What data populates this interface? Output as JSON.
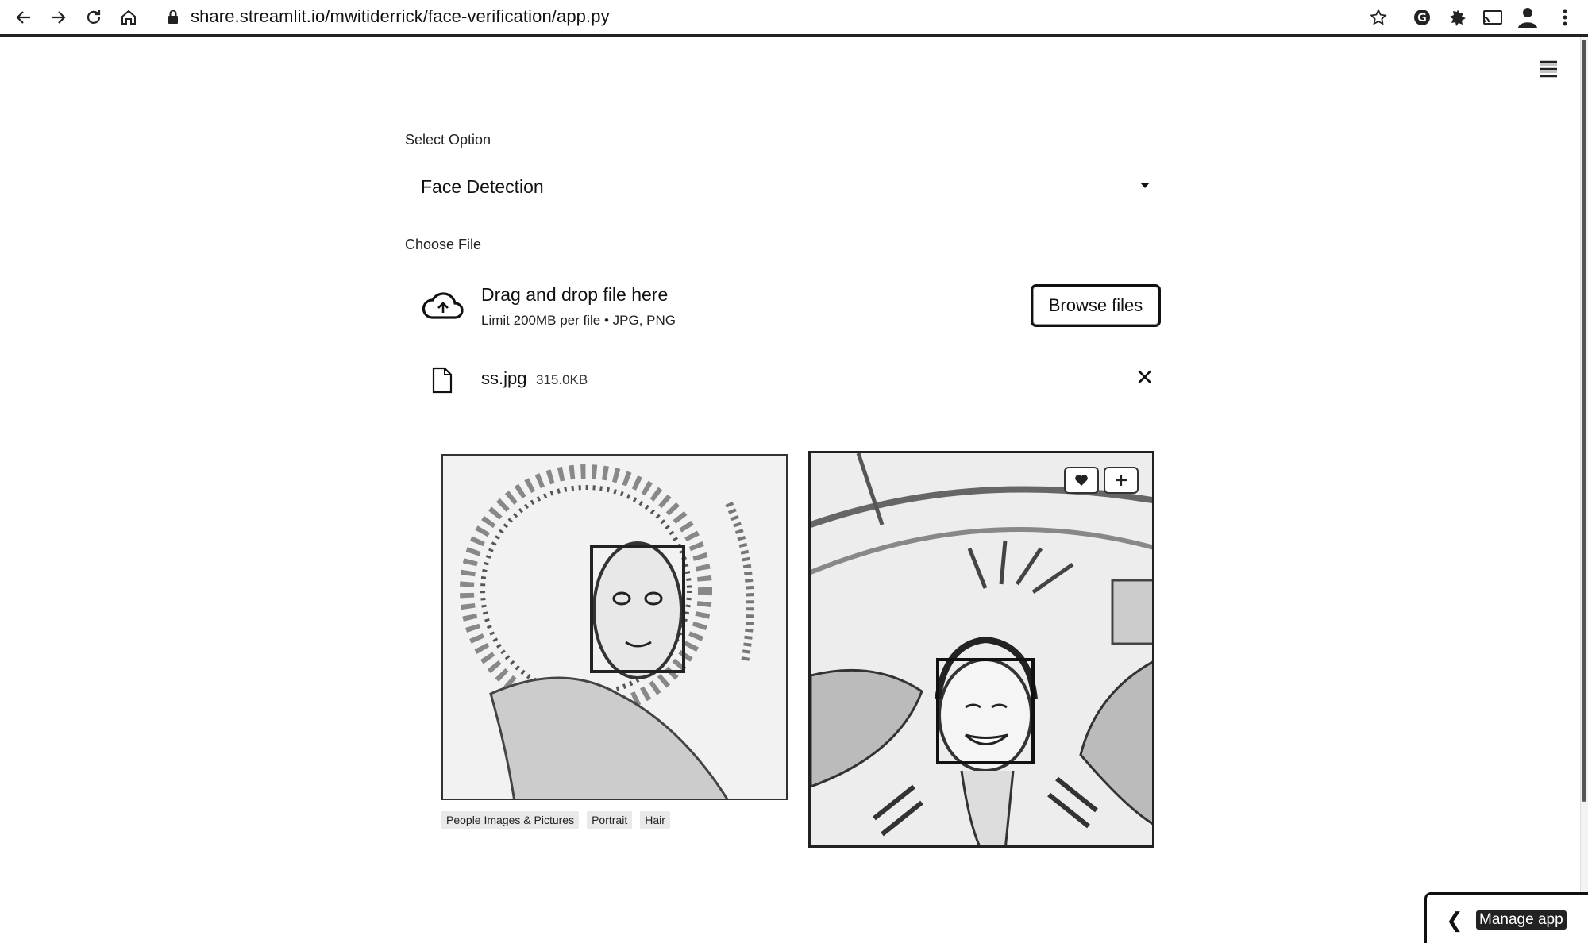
{
  "browser": {
    "url": "share.streamlit.io/mwitiderrick/face-verification/app.py",
    "icons": [
      "back-arrow-icon",
      "forward-arrow-icon",
      "reload-icon",
      "home-icon",
      "lock-icon",
      "star-icon",
      "grammarly-icon",
      "extension-icon",
      "cast-icon",
      "profile-avatar",
      "kebab-menu-icon"
    ]
  },
  "app": {
    "select_label": "Select Option",
    "select_value": "Face Detection",
    "file_label": "Choose File",
    "dropzone": {
      "title": "Drag and drop file here",
      "subtitle": "Limit 200MB per file • JPG, PNG",
      "browse_label": "Browse files"
    },
    "file": {
      "name": "ss.jpg",
      "size": "315.0KB"
    },
    "image_tags": [
      "People Images & Pictures",
      "Portrait",
      "Hair"
    ],
    "manage_label": "Manage app"
  }
}
